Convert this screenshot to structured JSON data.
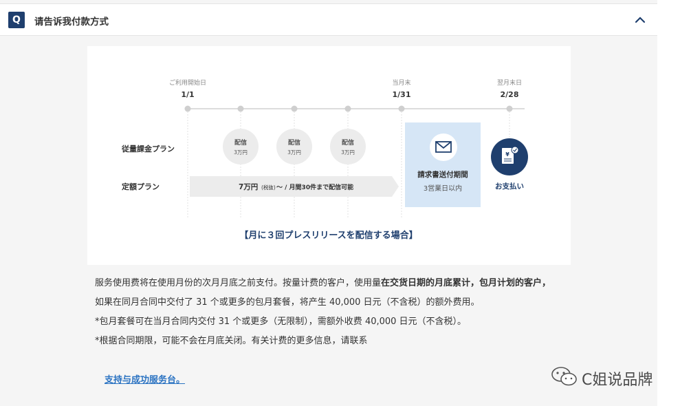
{
  "faq": {
    "badge": "Q",
    "question": "请告诉我付款方式"
  },
  "timeline": {
    "milestones": [
      {
        "caption": "ご利用開始日",
        "date": "1/1"
      },
      {
        "caption": "当月末",
        "date": "1/31"
      },
      {
        "caption": "翌月末日",
        "date": "2/28"
      }
    ],
    "row_labels": {
      "pay_per_use": "従量課金プラン",
      "fixed": "定額プラン"
    },
    "deliveries": [
      {
        "title": "配信",
        "amount": "3万円"
      },
      {
        "title": "配信",
        "amount": "3万円"
      },
      {
        "title": "配信",
        "amount": "3万円"
      }
    ],
    "fixed_plan": {
      "price": "7万円",
      "tax": "(税抜)",
      "detail": "〜 /  月間30件まで配信可能"
    },
    "invoice": {
      "title": "請求書送付期間",
      "subtitle": "3営業日以内"
    },
    "payment": {
      "label": "お支払い"
    },
    "caption": "【月に３回プレスリリースを配信する場合】"
  },
  "description": {
    "line1_normal": "服务使用费将在使用月份的次月月底之前支付。按量计费的客户，使用量",
    "line1_bold": "在交货日期的月底累计，包月计划的客户，",
    "line2": "如果在同月合同中交付了 31 个或更多的包月套餐，将产生 40,000 日元（不含税）的额外费用。",
    "line3": "*包月套餐可在当月合同内交付 31 个或更多（无限制），需额外收费 40,000 日元（不含税）。",
    "line4": "*根据合同期限，可能不会在月底关闭。有关计费的更多信息，请联系"
  },
  "support_link": "支持与成功服务台。",
  "watermark": "C姐说品牌",
  "colors": {
    "navy": "#1f3f6e",
    "invoice_bg": "#d6e6f6",
    "link": "#2b73c2"
  }
}
